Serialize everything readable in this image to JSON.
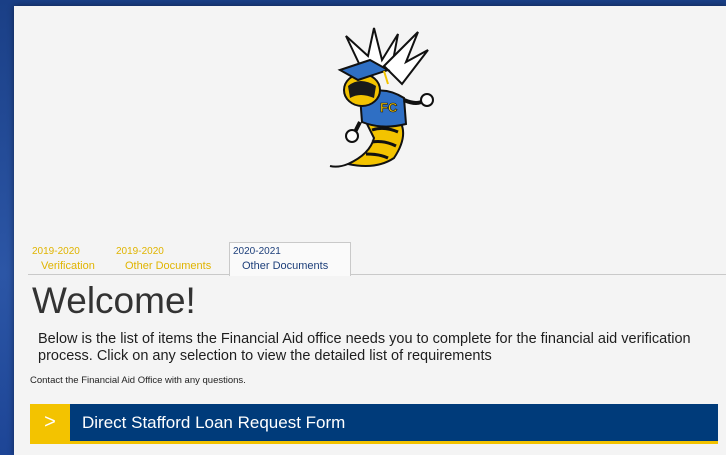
{
  "tabs": [
    {
      "year": "2019-2020",
      "name": "Verification",
      "active": false
    },
    {
      "year": "2019-2020",
      "name": "Other Documents",
      "active": false
    },
    {
      "year": "2020-2021",
      "name": "Other Documents",
      "active": true
    }
  ],
  "main": {
    "heading": "Welcome!",
    "intro": "Below is the list of items the Financial Aid office needs you to complete for the financial aid verification process. Click on any selection to view the detailed list of requirements",
    "contact": "Contact the Financial Aid Office with any questions."
  },
  "accordion": [
    {
      "title": "Direct Stafford Loan Request Form",
      "chevron": ">"
    }
  ],
  "mascot": {
    "icon": "hornet-mascot-logo",
    "badge_text": "FC"
  },
  "colors": {
    "page_background": "#2c56a6",
    "panel": "#f4f4f4",
    "accent_yellow": "#f3c300",
    "brand_navy": "#003b7a",
    "tab_inactive_text": "#e0b400",
    "tab_active_text": "#1d3f7a"
  }
}
